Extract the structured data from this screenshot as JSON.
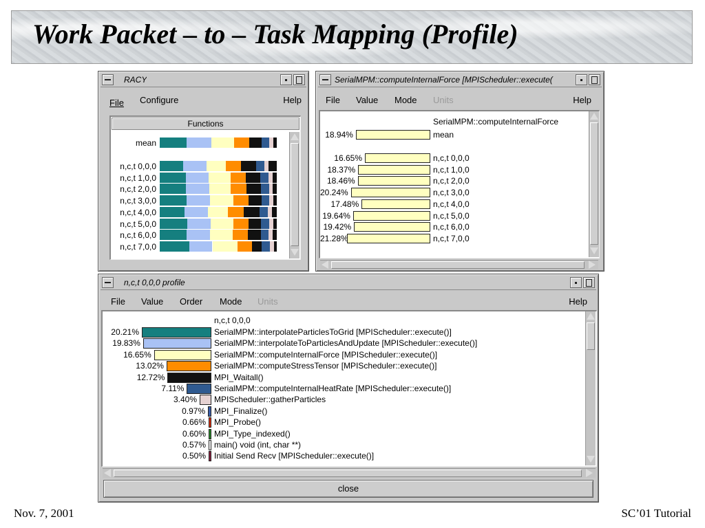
{
  "slide": {
    "title": "Work Packet – to – Task Mapping (Profile)",
    "footer_left": "Nov. 7, 2001",
    "footer_right": "SC’01 Tutorial"
  },
  "racy": {
    "title": "RACY",
    "menu": {
      "file": "File",
      "configure": "Configure",
      "help": "Help"
    },
    "functions_header": "Functions",
    "colors": [
      "#157f7f",
      "#a9c2f5",
      "#ffffc0",
      "#ff8c00",
      "#111111",
      "#2f5a90",
      "#e6d2d2",
      "#111111"
    ],
    "rows": [
      {
        "label": "mean",
        "fractions": [
          0.232,
          0.207,
          0.195,
          0.131,
          0.103,
          0.07,
          0.035,
          0.027
        ]
      },
      {
        "label": "n,c,t 0,0,0",
        "fractions": [
          0.202,
          0.198,
          0.167,
          0.13,
          0.127,
          0.071,
          0.034,
          0.071
        ]
      },
      {
        "label": "n,c,t 1,0,0",
        "fractions": [
          0.221,
          0.199,
          0.184,
          0.132,
          0.124,
          0.068,
          0.036,
          0.036
        ]
      },
      {
        "label": "n,c,t 2,0,0",
        "fractions": [
          0.222,
          0.201,
          0.185,
          0.133,
          0.123,
          0.069,
          0.034,
          0.033
        ]
      },
      {
        "label": "n,c,t 3,0,0",
        "fractions": [
          0.232,
          0.199,
          0.196,
          0.129,
          0.113,
          0.069,
          0.034,
          0.028
        ]
      },
      {
        "label": "n,c,t 4,0,0",
        "fractions": [
          0.212,
          0.197,
          0.175,
          0.131,
          0.136,
          0.071,
          0.036,
          0.042
        ]
      },
      {
        "label": "n,c,t 5,0,0",
        "fractions": [
          0.233,
          0.203,
          0.196,
          0.128,
          0.103,
          0.07,
          0.036,
          0.031
        ]
      },
      {
        "label": "n,c,t 6,0,0",
        "fractions": [
          0.229,
          0.202,
          0.194,
          0.13,
          0.108,
          0.069,
          0.035,
          0.033
        ]
      },
      {
        "label": "n,c,t 7,0,0",
        "fractions": [
          0.251,
          0.199,
          0.213,
          0.128,
          0.081,
          0.072,
          0.031,
          0.025
        ]
      }
    ]
  },
  "func_window": {
    "title": "SerialMPM::computeInternalForce [MPIScheduler::execute(",
    "menu": {
      "file": "File",
      "value": "Value",
      "mode": "Mode",
      "units": "Units",
      "help": "Help"
    },
    "function_name": "SerialMPM::computeInternalForce",
    "color": "#ffffc0",
    "rows": [
      {
        "pct": "18.94%",
        "value": 18.94,
        "label": "mean"
      },
      {
        "pct": "16.65%",
        "value": 16.65,
        "label": "n,c,t 0,0,0"
      },
      {
        "pct": "18.37%",
        "value": 18.37,
        "label": "n,c,t 1,0,0"
      },
      {
        "pct": "18.46%",
        "value": 18.46,
        "label": "n,c,t 2,0,0"
      },
      {
        "pct": "20.24%",
        "value": 20.24,
        "label": "n,c,t 3,0,0"
      },
      {
        "pct": "17.48%",
        "value": 17.48,
        "label": "n,c,t 4,0,0"
      },
      {
        "pct": "19.64%",
        "value": 19.64,
        "label": "n,c,t 5,0,0"
      },
      {
        "pct": "19.42%",
        "value": 19.42,
        "label": "n,c,t 6,0,0"
      },
      {
        "pct": "21.28%",
        "value": 21.28,
        "label": "n,c,t 7,0,0"
      }
    ]
  },
  "profile_window": {
    "title": "n,c,t 0,0,0 profile",
    "menu": {
      "file": "File",
      "value": "Value",
      "order": "Order",
      "mode": "Mode",
      "units": "Units",
      "help": "Help"
    },
    "header": "n,c,t 0,0,0",
    "close_label": "close",
    "rows": [
      {
        "pct": "20.21%",
        "value": 20.21,
        "color": "#157f7f",
        "label": "SerialMPM::interpolateParticlesToGrid [MPIScheduler::execute()]"
      },
      {
        "pct": "19.83%",
        "value": 19.83,
        "color": "#a9c2f5",
        "label": "SerialMPM::interpolateToParticlesAndUpdate [MPIScheduler::execute()]"
      },
      {
        "pct": "16.65%",
        "value": 16.65,
        "color": "#ffffc0",
        "label": "SerialMPM::computeInternalForce [MPIScheduler::execute()]"
      },
      {
        "pct": "13.02%",
        "value": 13.02,
        "color": "#ff8c00",
        "label": "SerialMPM::computeStressTensor [MPIScheduler::execute()]"
      },
      {
        "pct": "12.72%",
        "value": 12.72,
        "color": "#111111",
        "label": "MPI_Waitall()"
      },
      {
        "pct": "7.11%",
        "value": 7.11,
        "color": "#2f5a90",
        "label": "SerialMPM::computeInternalHeatRate [MPIScheduler::execute()]"
      },
      {
        "pct": "3.40%",
        "value": 3.4,
        "color": "#e6d2d2",
        "label": "MPIScheduler::gatherParticles"
      },
      {
        "pct": "0.97%",
        "value": 0.97,
        "color": "#3a5ea8",
        "label": "MPI_Finalize()"
      },
      {
        "pct": "0.66%",
        "value": 0.66,
        "color": "#e03010",
        "label": "MPI_Probe()"
      },
      {
        "pct": "0.60%",
        "value": 0.6,
        "color": "#2a8a2a",
        "label": "MPI_Type_indexed()"
      },
      {
        "pct": "0.57%",
        "value": 0.57,
        "color": "#ffffff",
        "label": "main() void (int, char **)"
      },
      {
        "pct": "0.50%",
        "value": 0.5,
        "color": "#8a2040",
        "label": "Initial Send Recv [MPIScheduler::execute()]"
      }
    ]
  }
}
